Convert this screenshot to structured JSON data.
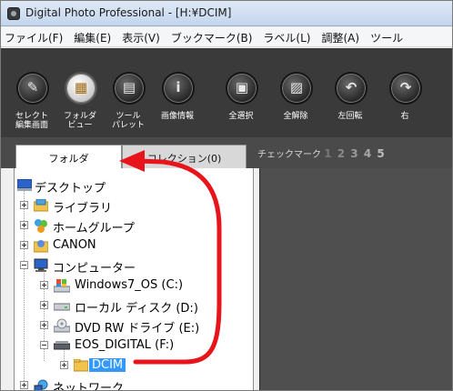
{
  "window": {
    "title": "Digital Photo Professional - [H:¥DCIM]"
  },
  "menu": {
    "items": [
      "ファイル(F)",
      "編集(E)",
      "表示(V)",
      "ブックマーク(B)",
      "ラベル(L)",
      "調整(A)",
      "ツール"
    ]
  },
  "toolbar": {
    "buttons": [
      {
        "name": "edit-window",
        "line1": "セレクト",
        "line2": "編集画面",
        "glyph": "✎"
      },
      {
        "name": "folder-view",
        "line1": "フォルダ",
        "line2": "ビュー",
        "glyph": "▦",
        "active": true
      },
      {
        "name": "tool-palette",
        "line1": "ツール",
        "line2": "パレット",
        "glyph": "▤"
      },
      {
        "name": "image-info",
        "line1": "画像情報",
        "line2": "",
        "glyph": "i"
      },
      {
        "name": "select-all",
        "line1": "全選択",
        "line2": "",
        "glyph": "▣"
      },
      {
        "name": "deselect-all",
        "line1": "全解除",
        "line2": "",
        "glyph": "▨"
      },
      {
        "name": "rotate-left",
        "line1": "左回転",
        "line2": "",
        "glyph": "↶"
      },
      {
        "name": "rotate-right",
        "line1": "右",
        "line2": "",
        "glyph": "↷"
      }
    ]
  },
  "tabs": {
    "folder": "フォルダ",
    "collection": "コレクション(0)"
  },
  "check_mark": {
    "label": "チェックマーク",
    "numbers": [
      "1",
      "2",
      "3",
      "4",
      "5"
    ]
  },
  "tree": {
    "desktop": "デスクトップ",
    "libraries": "ライブラリ",
    "homegroup": "ホームグループ",
    "canon": "CANON",
    "computer": "コンピューター",
    "drive_c": "Windows7_OS (C:)",
    "drive_d": "ローカル ディスク (D:)",
    "drive_e": "DVD RW ドライブ (E:)",
    "drive_f": "EOS_DIGITAL (F:)",
    "dcim": "DCIM",
    "network": "ネットワーク"
  },
  "colors": {
    "annotation_arrow": "#e8141b",
    "selection": "#3399ff",
    "toolbar_bg": "#3a3a3a"
  }
}
